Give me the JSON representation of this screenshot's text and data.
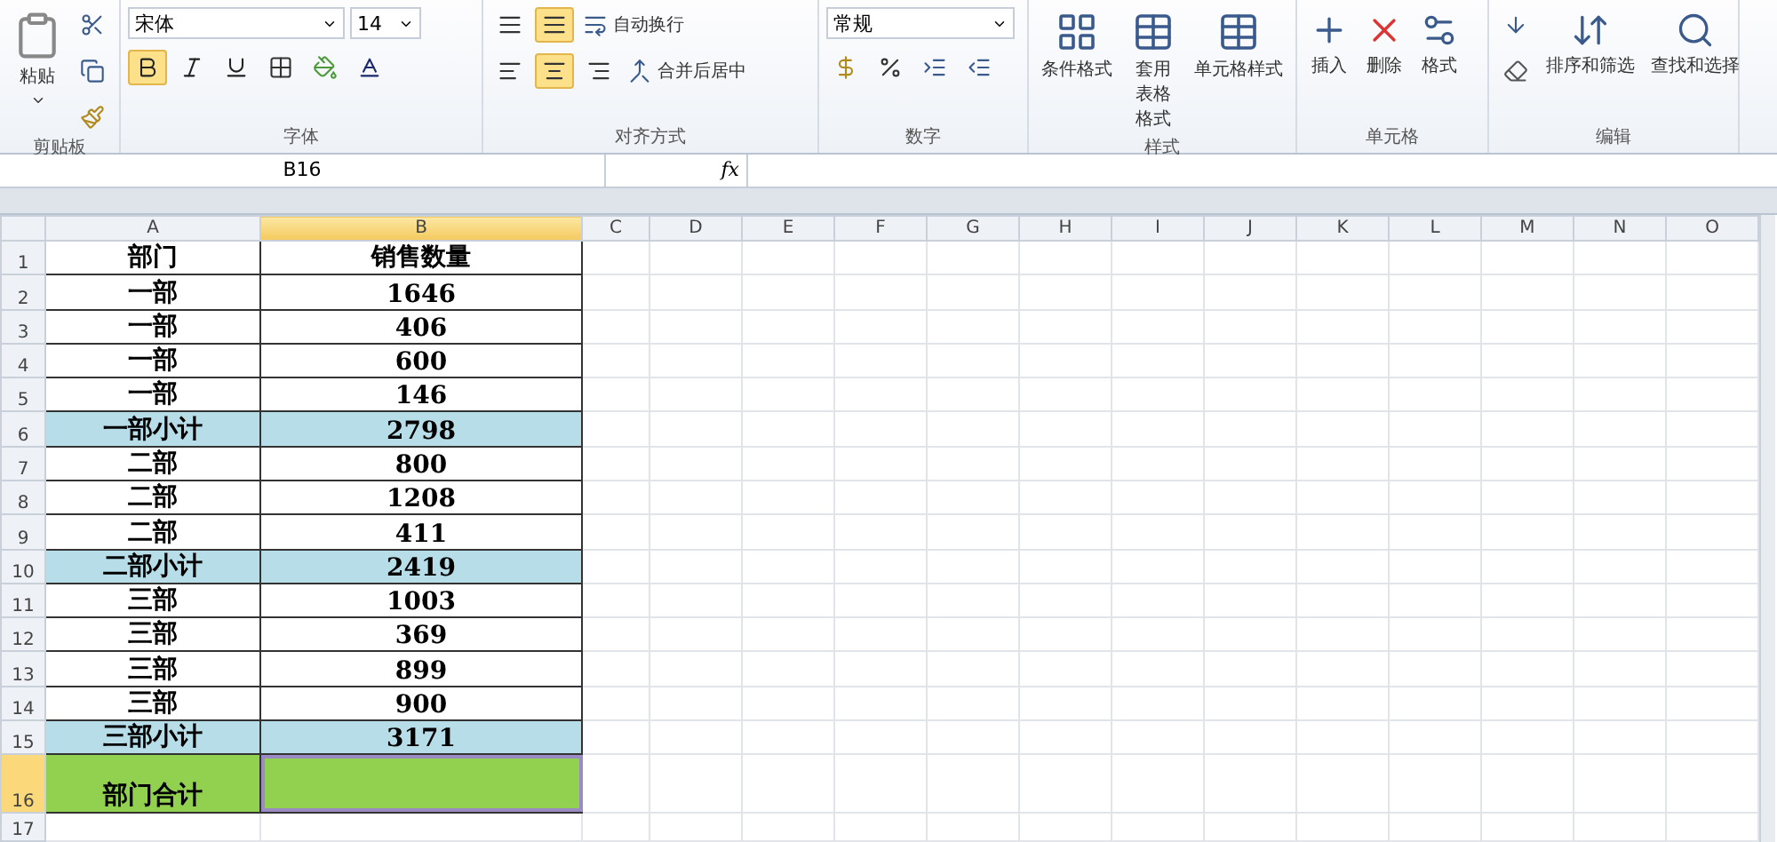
{
  "ribbon": {
    "clipboard": {
      "label": "剪贴板",
      "paste": "粘贴"
    },
    "font": {
      "label": "字体",
      "font_name": "宋体",
      "font_size": "14",
      "bold": true,
      "italic": false,
      "underline": false
    },
    "alignment": {
      "label": "对齐方式",
      "wrap": "自动换行",
      "merge": "合并后居中",
      "middle_align": true,
      "center_align": true
    },
    "number": {
      "label": "数字",
      "format": "常规"
    },
    "styles": {
      "label": "样式",
      "buttons": [
        "条件格式",
        "套用表格格式",
        "单元格样式"
      ]
    },
    "cells": {
      "label": "单元格",
      "buttons": [
        "插入",
        "删除",
        "格式"
      ]
    },
    "editing": {
      "label": "编辑",
      "buttons": [
        "排序和筛选",
        "查找和选择"
      ]
    }
  },
  "formula_bar": {
    "name_box": "B16",
    "fx": "fx"
  },
  "columns": [
    {
      "label": "A",
      "selected": false
    },
    {
      "label": "B",
      "selected": true
    },
    {
      "label": "C",
      "selected": false
    },
    {
      "label": "D",
      "selected": false
    },
    {
      "label": "E",
      "selected": false
    },
    {
      "label": "F",
      "selected": false
    },
    {
      "label": "G",
      "selected": false
    },
    {
      "label": "H",
      "selected": false
    },
    {
      "label": "I",
      "selected": false
    },
    {
      "label": "J",
      "selected": false
    },
    {
      "label": "K",
      "selected": false
    },
    {
      "label": "L",
      "selected": false
    },
    {
      "label": "M",
      "selected": false
    },
    {
      "label": "N",
      "selected": false
    },
    {
      "label": "O",
      "selected": false
    }
  ],
  "rows": [
    {
      "number": "1",
      "kind": "header",
      "selected": false,
      "a": "部门",
      "b": "销售数量"
    },
    {
      "number": "2",
      "kind": "data",
      "selected": false,
      "a": "一部",
      "b": "1646"
    },
    {
      "number": "3",
      "kind": "data",
      "selected": false,
      "a": "一部",
      "b": "406"
    },
    {
      "number": "4",
      "kind": "data",
      "selected": false,
      "a": "一部",
      "b": "600"
    },
    {
      "number": "5",
      "kind": "data",
      "selected": false,
      "a": "一部",
      "b": "146"
    },
    {
      "number": "6",
      "kind": "subtotal",
      "selected": false,
      "a": "一部小计",
      "b": "2798"
    },
    {
      "number": "7",
      "kind": "data",
      "selected": false,
      "a": "二部",
      "b": "800"
    },
    {
      "number": "8",
      "kind": "data",
      "selected": false,
      "a": "二部",
      "b": "1208"
    },
    {
      "number": "9",
      "kind": "data",
      "selected": false,
      "a": "二部",
      "b": "411"
    },
    {
      "number": "10",
      "kind": "subtotal",
      "selected": false,
      "a": "二部小计",
      "b": "2419"
    },
    {
      "number": "11",
      "kind": "data",
      "selected": false,
      "a": "三部",
      "b": "1003"
    },
    {
      "number": "12",
      "kind": "data",
      "selected": false,
      "a": "三部",
      "b": "369"
    },
    {
      "number": "13",
      "kind": "data",
      "selected": false,
      "a": "三部",
      "b": "899"
    },
    {
      "number": "14",
      "kind": "data",
      "selected": false,
      "a": "三部",
      "b": "900"
    },
    {
      "number": "15",
      "kind": "subtotal",
      "selected": false,
      "a": "三部小计",
      "b": "3171"
    },
    {
      "number": "16",
      "kind": "total",
      "selected": true,
      "a": "部门合计"
    },
    {
      "number": "17",
      "kind": "empty",
      "selected": false
    }
  ]
}
